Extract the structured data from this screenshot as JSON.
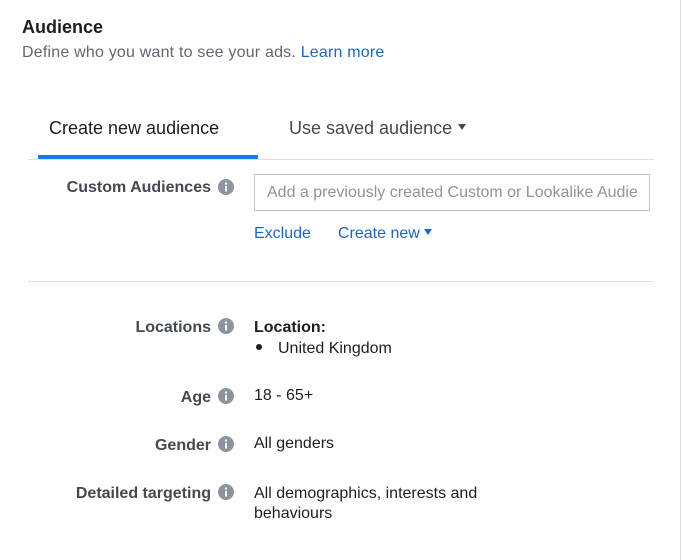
{
  "header": {
    "title": "Audience",
    "subtitle": "Define who you want to see your ads.",
    "learn_more": "Learn more"
  },
  "tabs": [
    {
      "label": "Create new audience",
      "active": true
    },
    {
      "label": "Use saved audience",
      "active": false
    }
  ],
  "custom_audiences": {
    "label": "Custom Audiences",
    "placeholder": "Add a previously created Custom or Lookalike Audience",
    "exclude": "Exclude",
    "create_new": "Create new"
  },
  "locations": {
    "label": "Locations",
    "heading": "Location:",
    "items": [
      "United Kingdom"
    ]
  },
  "age": {
    "label": "Age",
    "value": "18 - 65+"
  },
  "gender": {
    "label": "Gender",
    "value": "All genders"
  },
  "detailed_targeting": {
    "label": "Detailed targeting",
    "value_line1": "All demographics, interests and",
    "value_line2": "behaviours"
  },
  "icons": {
    "info": "info-icon",
    "caret": "caret-down-icon"
  },
  "colors": {
    "accent": "#1877f2",
    "link": "#1a66c7",
    "label": "#444950",
    "muted": "#606770"
  }
}
